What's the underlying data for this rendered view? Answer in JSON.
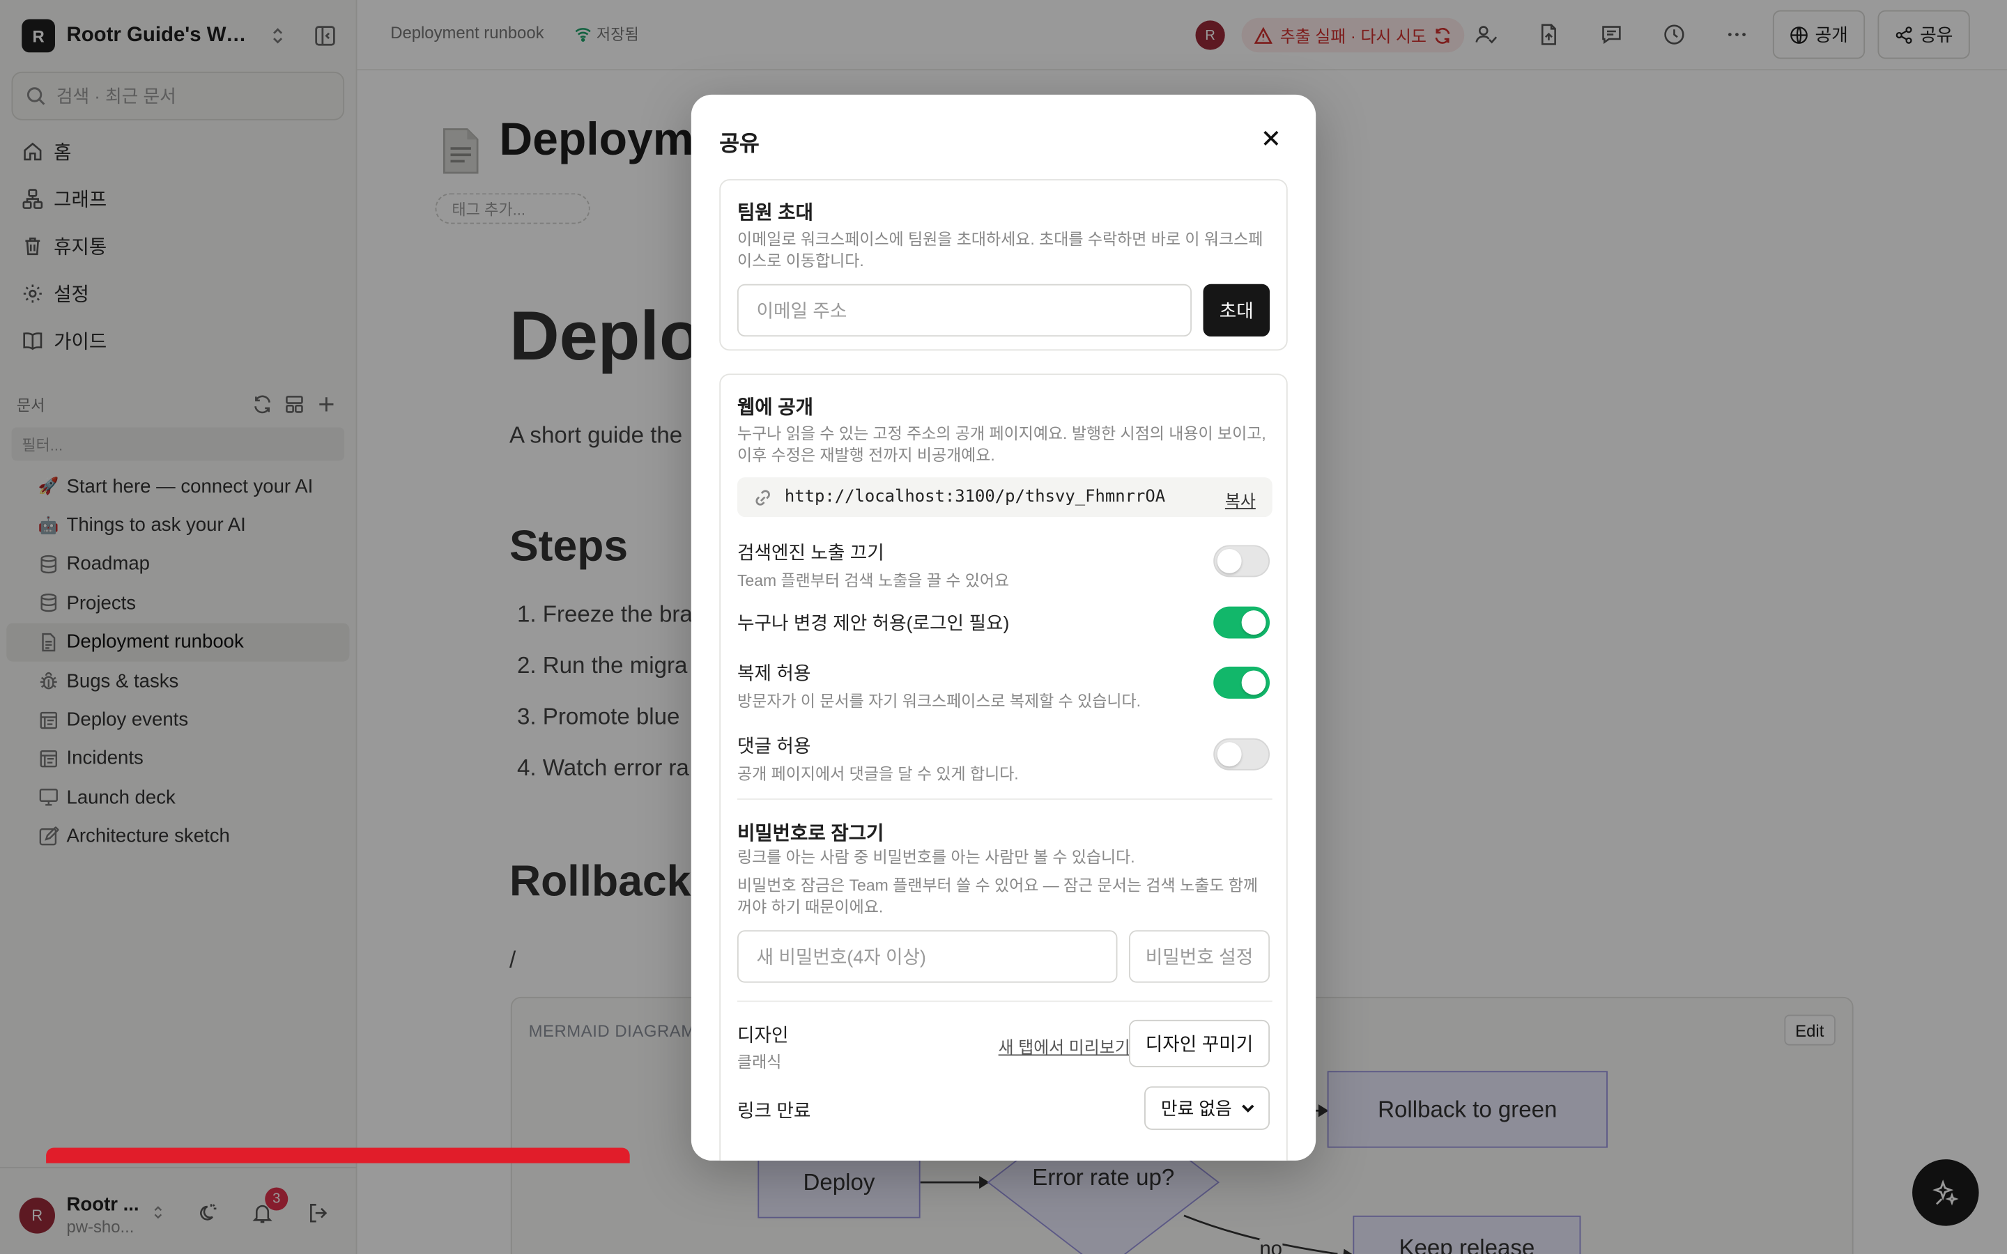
{
  "sidebar": {
    "workspace_initial": "R",
    "workspace_name": "Rootr Guide's Wor...",
    "search_placeholder": "검색 · 최근 문서",
    "nav": [
      {
        "label": "홈",
        "icon": "home-icon"
      },
      {
        "label": "그래프",
        "icon": "graph-icon"
      },
      {
        "label": "휴지통",
        "icon": "trash-icon"
      },
      {
        "label": "설정",
        "icon": "gear-icon"
      },
      {
        "label": "가이드",
        "icon": "book-icon"
      }
    ],
    "section_label": "문서",
    "filter_placeholder": "필터...",
    "docs": [
      {
        "emoji": "🚀",
        "label": "Start here — connect your AI",
        "icon": "rocket-icon"
      },
      {
        "emoji": "🤖",
        "label": "Things to ask your AI",
        "icon": "robot-icon"
      },
      {
        "label": "Roadmap",
        "icon": "database-icon"
      },
      {
        "label": "Projects",
        "icon": "database-icon"
      },
      {
        "label": "Deployment runbook",
        "icon": "document-icon",
        "active": true
      },
      {
        "label": "Bugs & tasks",
        "icon": "bug-icon"
      },
      {
        "label": "Deploy events",
        "icon": "timeline-icon"
      },
      {
        "label": "Incidents",
        "icon": "timeline-icon"
      },
      {
        "label": "Launch deck",
        "icon": "presentation-icon"
      },
      {
        "label": "Architecture sketch",
        "icon": "sketch-icon"
      }
    ],
    "user": {
      "initial": "R",
      "name": "Rootr ...",
      "sub": "pw-sho..."
    },
    "notification_count": "3"
  },
  "topbar": {
    "breadcrumb": "Deployment runbook",
    "saved_status": "저장됨",
    "avatar_initial": "R",
    "error_text": "추출 실패 · 다시 시도",
    "publish_label": "공개",
    "share_label": "공유"
  },
  "document": {
    "tag_placeholder": "태그 추가...",
    "title": "Deployme",
    "heading": "Deplo",
    "intro": "A short guide the",
    "steps_heading": "Steps",
    "steps": [
      {
        "n": "1.",
        "text": "Freeze the bra"
      },
      {
        "n": "2.",
        "text": "Run the migra"
      },
      {
        "n": "3.",
        "text": "Promote blue"
      },
      {
        "n": "4.",
        "text": "Watch error ra"
      }
    ],
    "rollback_heading": "Rollback",
    "slash": "/",
    "mermaid": {
      "label": "MERMAID DIAGRAM",
      "edit_label": "Edit",
      "nodes": {
        "deploy": "Deploy",
        "decision": "Error rate up?",
        "rollback": "Rollback to green",
        "keep": "Keep release"
      },
      "edge_no": "no"
    }
  },
  "share_modal": {
    "title": "공유",
    "invite": {
      "title": "팀원 초대",
      "desc": "이메일로 워크스페이스에 팀원을 초대하세요. 초대를 수락하면 바로 이 워크스페이스로 이동합니다.",
      "email_placeholder": "이메일 주소",
      "button": "초대"
    },
    "publish": {
      "title": "웹에 공개",
      "desc": "누구나 읽을 수 있는 고정 주소의 공개 페이지예요. 발행한 시점의 내용이 보이고, 이후 수정은 재발행 전까지 비공개예요.",
      "url": "http://localhost:3100/p/thsvy_FhmnrrOA",
      "copy": "복사",
      "options": [
        {
          "title": "검색엔진 노출 끄기",
          "desc": "Team 플랜부터 검색 노출을 끌 수 있어요",
          "on": false
        },
        {
          "title": "누구나 변경 제안 허용(로그인 필요)",
          "desc": "",
          "on": true
        },
        {
          "title": "복제 허용",
          "desc": "방문자가 이 문서를 자기 워크스페이스로 복제할 수 있습니다.",
          "on": true
        },
        {
          "title": "댓글 허용",
          "desc": "공개 페이지에서 댓글을 달 수 있게 합니다.",
          "on": false
        }
      ],
      "password": {
        "title": "비밀번호로 잠그기",
        "desc1": "링크를 아는 사람 중 비밀번호를 아는 사람만 볼 수 있습니다.",
        "desc2": "비밀번호 잠금은 Team 플랜부터 쓸 수 있어요 — 잠근 문서는 검색 노출도 함께 꺼야 하기 때문이에요.",
        "placeholder": "새 비밀번호(4자 이상)",
        "button": "비밀번호 설정"
      },
      "design": {
        "title": "디자인",
        "value": "클래식",
        "preview": "새 탭에서 미리보기",
        "customize": "디자인 꾸미기"
      },
      "expiry": {
        "label": "링크 만료",
        "value": "만료 없음"
      }
    }
  },
  "colors": {
    "toggle_on": "#12b76a",
    "danger": "#e11d2a",
    "error_text": "#d0302e",
    "avatar": "#9c2a3a"
  }
}
